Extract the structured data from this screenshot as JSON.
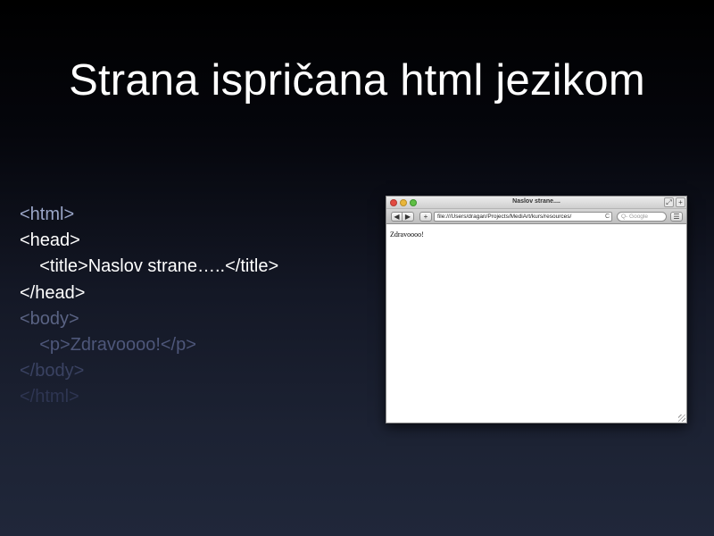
{
  "slide": {
    "title": "Strana ispričana html jezikom"
  },
  "code": {
    "lines": [
      {
        "text": "<html>",
        "color": "#9aa6c8"
      },
      {
        "text": "<head>",
        "color": "#ffffff"
      },
      {
        "text": "    <title>Naslov strane…..</title>",
        "color": "#ffffff"
      },
      {
        "text": "</head>",
        "color": "#ffffff"
      },
      {
        "text": "<body>",
        "color": "#5a6384"
      },
      {
        "text": "    <p>Zdravoooo!</p>",
        "color": "#4e577a"
      },
      {
        "text": "</body>",
        "color": "#3a4262"
      },
      {
        "text": "</html>",
        "color": "#2e3552"
      }
    ]
  },
  "browser": {
    "window_title": "Naslov strane....",
    "back_icon": "◀",
    "forward_icon": "▶",
    "add_icon": "+",
    "address": "file:///Users/dragan/Projects/MediArt/kurs/resources/",
    "reload_icon": "C",
    "search_placeholder": "Q- Google",
    "menu_icon": "☰",
    "page_text": "Zdravoooo!",
    "resize_icon": "⤢",
    "newtab_icon": "+"
  }
}
